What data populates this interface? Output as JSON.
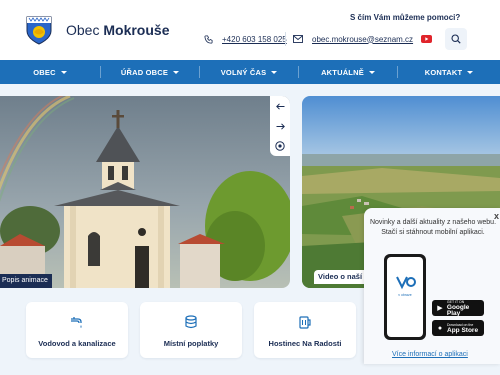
{
  "header": {
    "brand_prefix": "Obec",
    "brand_name": "Mokrouše",
    "help_text": "S čím Vám můžeme pomoci?",
    "phone": "+420 603 158 025",
    "email": "obec.mokrouse@seznam.cz",
    "icons": [
      "phone-icon",
      "mail-icon",
      "youtube-icon",
      "search-icon"
    ]
  },
  "nav": {
    "items": [
      {
        "label": "OBEC"
      },
      {
        "label": "ÚŘAD OBCE"
      },
      {
        "label": "VOLNÝ ČAS"
      },
      {
        "label": "AKTUÁLNĚ"
      },
      {
        "label": "KONTAKT"
      }
    ]
  },
  "hero": {
    "caption": "Popis animace"
  },
  "video": {
    "caption": "Video o naší"
  },
  "cards": [
    {
      "label": "Vodovod a kanalizace",
      "icon": "water-tap-icon"
    },
    {
      "label": "Místní poplatky",
      "icon": "coins-icon"
    },
    {
      "label": "Hostinec Na Radosti",
      "icon": "beer-mug-icon"
    }
  ],
  "popup": {
    "close": "x",
    "text": "Novinky a další aktuality z našeho webu. Stačí si stáhnout mobilní aplikaci.",
    "google_small": "GET IT ON",
    "google_big": "Google Play",
    "apple_small": "Download on the",
    "apple_big": "App Store",
    "link": "Více informací o aplikaci",
    "app_brand": "v obraze"
  },
  "colors": {
    "nav_bg": "#1d6fb8",
    "brand_dark": "#1b2d54",
    "accent_red": "#e0242b"
  }
}
